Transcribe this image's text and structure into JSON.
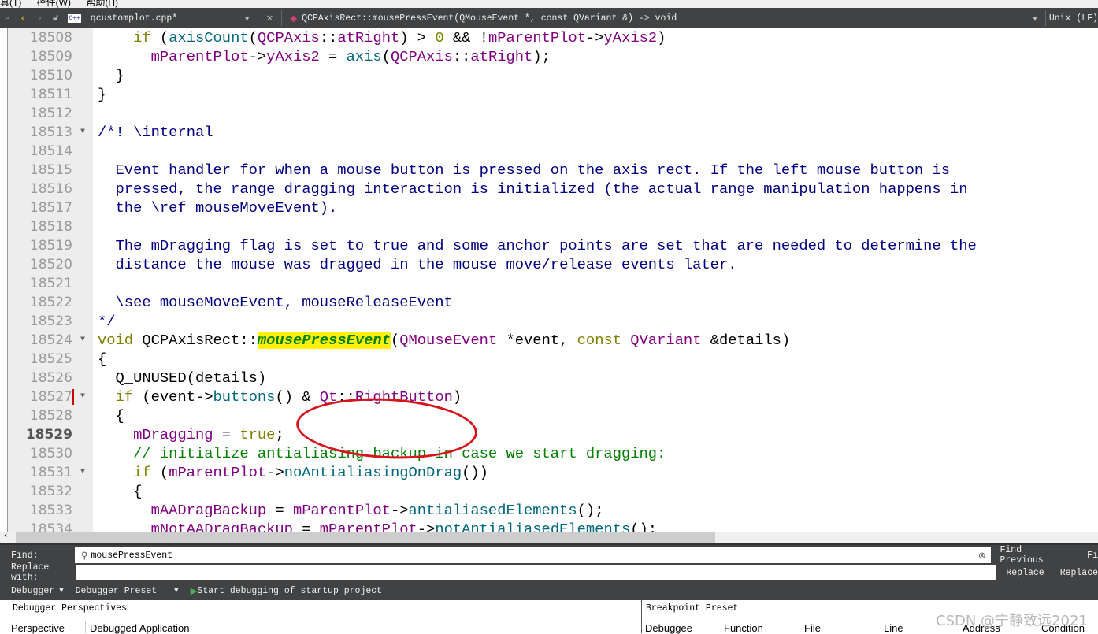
{
  "menu": [
    "具(T)",
    "控件(W)",
    "帮助(H)"
  ],
  "tabbar": {
    "file": "qcustomplot.cpp*",
    "symbol": "QCPAxisRect::mousePressEvent(QMouseEvent *, const QVariant &) -> void",
    "line_ending": "Unix (LF)"
  },
  "editor": {
    "current_line": "18529",
    "lines": [
      {
        "n": "18508",
        "t": [
          [
            "    ",
            ""
          ],
          [
            "if",
            "kw"
          ],
          [
            " (",
            ""
          ],
          [
            "axisCount",
            "fn"
          ],
          [
            "(",
            ""
          ],
          [
            "QCPAxis",
            "ty"
          ],
          [
            "::",
            ""
          ],
          [
            "atRight",
            "ty"
          ],
          [
            ") > ",
            ""
          ],
          [
            "0",
            "kw"
          ],
          [
            " && !",
            ""
          ],
          [
            "mParentPlot",
            "ty"
          ],
          [
            "->",
            ""
          ],
          [
            "yAxis2",
            "ty"
          ],
          [
            ")",
            ""
          ]
        ]
      },
      {
        "n": "18509",
        "t": [
          [
            "      ",
            ""
          ],
          [
            "mParentPlot",
            "ty"
          ],
          [
            "->",
            ""
          ],
          [
            "yAxis2",
            "ty"
          ],
          [
            " = ",
            ""
          ],
          [
            "axis",
            "fn"
          ],
          [
            "(",
            ""
          ],
          [
            "QCPAxis",
            "ty"
          ],
          [
            "::",
            ""
          ],
          [
            "atRight",
            "ty"
          ],
          [
            ");",
            ""
          ]
        ]
      },
      {
        "n": "18510",
        "t": [
          [
            "  }",
            ""
          ]
        ]
      },
      {
        "n": "18511",
        "t": [
          [
            "}",
            ""
          ]
        ]
      },
      {
        "n": "18512",
        "t": []
      },
      {
        "n": "18513",
        "fold": true,
        "t": [
          [
            "/*! \\internal",
            "cm"
          ]
        ]
      },
      {
        "n": "18514",
        "t": []
      },
      {
        "n": "18515",
        "t": [
          [
            "  Event handler for when a mouse button is pressed on the axis rect. If the left mouse button is",
            "cm"
          ]
        ]
      },
      {
        "n": "18516",
        "t": [
          [
            "  pressed, the range dragging interaction is initialized (the actual range manipulation happens in",
            "cm"
          ]
        ]
      },
      {
        "n": "18517",
        "t": [
          [
            "  the \\ref mouseMoveEvent).",
            "cm"
          ]
        ]
      },
      {
        "n": "18518",
        "t": []
      },
      {
        "n": "18519",
        "t": [
          [
            "  The mDragging flag is set to true and some anchor points are set that are needed to determine the",
            "cm"
          ]
        ]
      },
      {
        "n": "18520",
        "t": [
          [
            "  distance the mouse was dragged in the mouse move/release events later.",
            "cm"
          ]
        ]
      },
      {
        "n": "18521",
        "t": []
      },
      {
        "n": "18522",
        "t": [
          [
            "  \\see mouseMoveEvent, mouseReleaseEvent",
            "cm"
          ]
        ]
      },
      {
        "n": "18523",
        "t": [
          [
            "*/",
            "cm"
          ]
        ]
      },
      {
        "n": "18524",
        "fold": true,
        "t": [
          [
            "void",
            "kw"
          ],
          [
            " QCPAxisRect::",
            ""
          ],
          [
            "mousePressEvent",
            "hl"
          ],
          [
            "(",
            ""
          ],
          [
            "QMouseEvent",
            "ty"
          ],
          [
            " *event, ",
            ""
          ],
          [
            "const",
            "kw"
          ],
          [
            " ",
            ""
          ],
          [
            "QVariant",
            "ty"
          ],
          [
            " &details)",
            ""
          ]
        ]
      },
      {
        "n": "18525",
        "t": [
          [
            "{",
            ""
          ]
        ]
      },
      {
        "n": "18526",
        "t": [
          [
            "  Q_UNUSED(details)",
            ""
          ]
        ]
      },
      {
        "n": "18527",
        "fold": true,
        "mark": true,
        "t": [
          [
            "  ",
            ""
          ],
          [
            "if",
            "kw"
          ],
          [
            " (event->",
            ""
          ],
          [
            "buttons",
            "fn"
          ],
          [
            "() & ",
            ""
          ],
          [
            "Qt",
            "ty"
          ],
          [
            "::",
            ""
          ],
          [
            "RightButton",
            "ty"
          ],
          [
            ")",
            ""
          ]
        ]
      },
      {
        "n": "18528",
        "t": [
          [
            "  {",
            ""
          ]
        ]
      },
      {
        "n": "18529",
        "t": [
          [
            "    ",
            ""
          ],
          [
            "mDragging",
            "ty"
          ],
          [
            " = ",
            ""
          ],
          [
            "true",
            "kw"
          ],
          [
            ";",
            ""
          ]
        ]
      },
      {
        "n": "18530",
        "t": [
          [
            "    ",
            ""
          ],
          [
            "// initialize antialiasing backup in case we start dragging:",
            "lc"
          ]
        ]
      },
      {
        "n": "18531",
        "fold": true,
        "t": [
          [
            "    ",
            ""
          ],
          [
            "if",
            "kw"
          ],
          [
            " (",
            ""
          ],
          [
            "mParentPlot",
            "ty"
          ],
          [
            "->",
            ""
          ],
          [
            "noAntialiasingOnDrag",
            "fn"
          ],
          [
            "())",
            ""
          ]
        ]
      },
      {
        "n": "18532",
        "t": [
          [
            "    {",
            ""
          ]
        ]
      },
      {
        "n": "18533",
        "t": [
          [
            "      ",
            ""
          ],
          [
            "mAADragBackup",
            "ty"
          ],
          [
            " = ",
            ""
          ],
          [
            "mParentPlot",
            "ty"
          ],
          [
            "->",
            ""
          ],
          [
            "antialiasedElements",
            "fn"
          ],
          [
            "();",
            ""
          ]
        ]
      },
      {
        "n": "18534",
        "t": [
          [
            "      ",
            ""
          ],
          [
            "mNotAADragBackup",
            "ty"
          ],
          [
            " = ",
            ""
          ],
          [
            "mParentPlot",
            "ty"
          ],
          [
            "->",
            ""
          ],
          [
            "notAntialiasedElements",
            "fn"
          ],
          [
            "();",
            ""
          ]
        ]
      }
    ]
  },
  "find": {
    "find_label": "Find:",
    "find_value": "mousePressEvent",
    "replace_label": "Replace with:",
    "replace_value": "",
    "find_previous": "Find Previous",
    "find_next": "Fi",
    "replace": "Replace",
    "replace_all": "Replace"
  },
  "debugger": {
    "mode": "Debugger",
    "preset": "Debugger Preset",
    "start": "Start debugging of startup project"
  },
  "panels": {
    "left_title": "Debugger Perspectives",
    "left_cols": [
      "Perspective",
      "Debugged Application"
    ],
    "right_title": "Breakpoint Preset",
    "right_cols": [
      "Debuggee",
      "Function",
      "File",
      "Line",
      "Address",
      "Condition"
    ]
  },
  "watermark": "CSDN @宁静致远2021",
  "colors": {
    "keyword": "#808000",
    "type": "#800080",
    "function": "#00677c",
    "comment": "#000080",
    "line_comment": "#008000",
    "highlight": "#ffef0b",
    "annotation": "#d8141b"
  }
}
